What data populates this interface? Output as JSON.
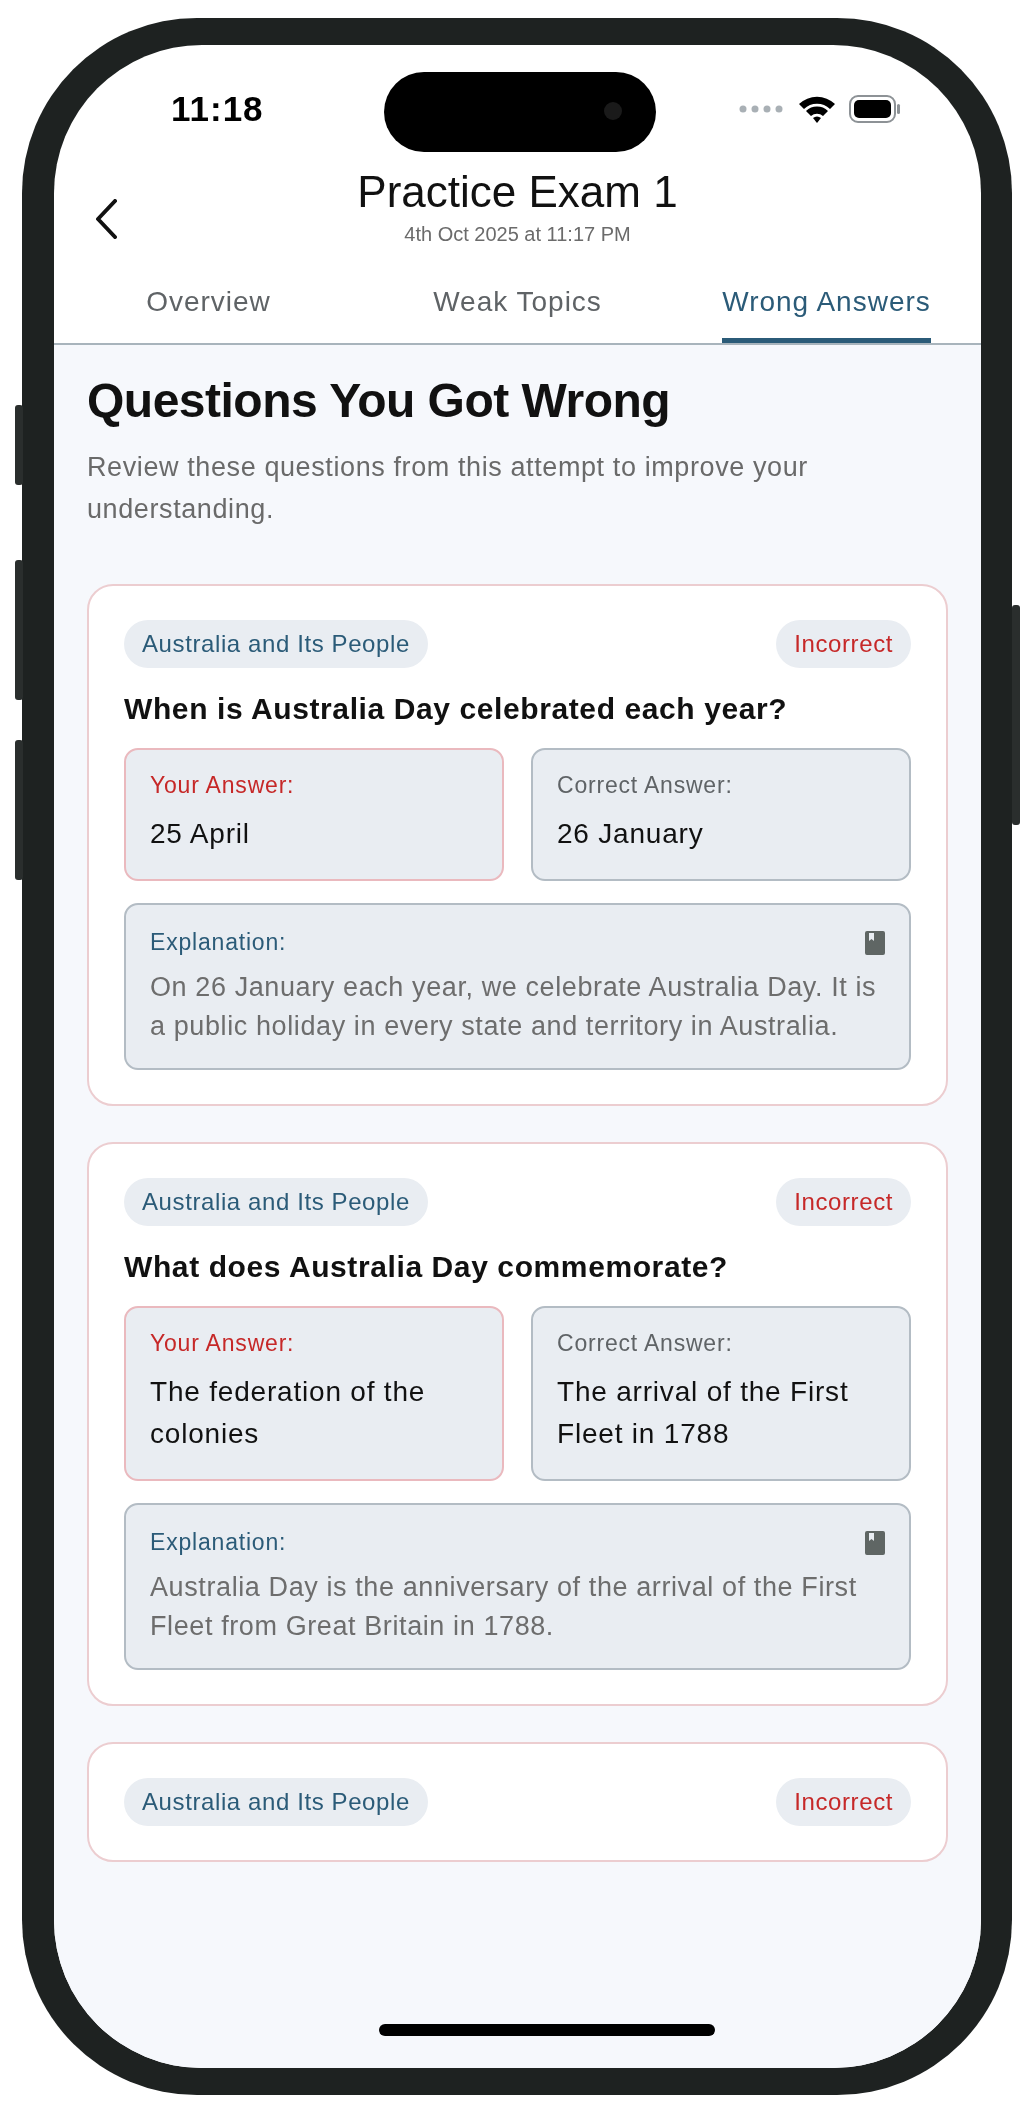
{
  "status_bar": {
    "time": "11:18"
  },
  "header": {
    "title": "Practice Exam 1",
    "subtitle": "4th Oct 2025 at 11:17 PM"
  },
  "tabs": [
    {
      "label": "Overview",
      "selected": false
    },
    {
      "label": "Weak Topics",
      "selected": false
    },
    {
      "label": "Wrong Answers",
      "selected": true
    }
  ],
  "heading": "Questions You Got Wrong",
  "description": "Review these questions from this attempt to improve your understanding.",
  "questions": [
    {
      "topic": "Australia and Its People",
      "status": "Incorrect",
      "question": "When is Australia Day celebrated each year?",
      "your_answer_label": "Your Answer:",
      "your_answer": "25 April",
      "correct_answer_label": "Correct Answer:",
      "correct_answer": "26 January",
      "explanation_label": "Explanation:",
      "explanation": "On 26 January each year, we celebrate Australia Day. It is a public holiday in every state and territory in Australia."
    },
    {
      "topic": "Australia and Its People",
      "status": "Incorrect",
      "question": "What does Australia Day commemorate?",
      "your_answer_label": "Your Answer:",
      "your_answer": "The federation of the colonies",
      "correct_answer_label": "Correct Answer:",
      "correct_answer": "The arrival of the First Fleet in 1788",
      "explanation_label": "Explanation:",
      "explanation": "Australia Day is the anniversary of the arrival of the First Fleet from Great Britain in 1788."
    },
    {
      "topic": "Australia and Its People",
      "status": "Incorrect"
    }
  ]
}
